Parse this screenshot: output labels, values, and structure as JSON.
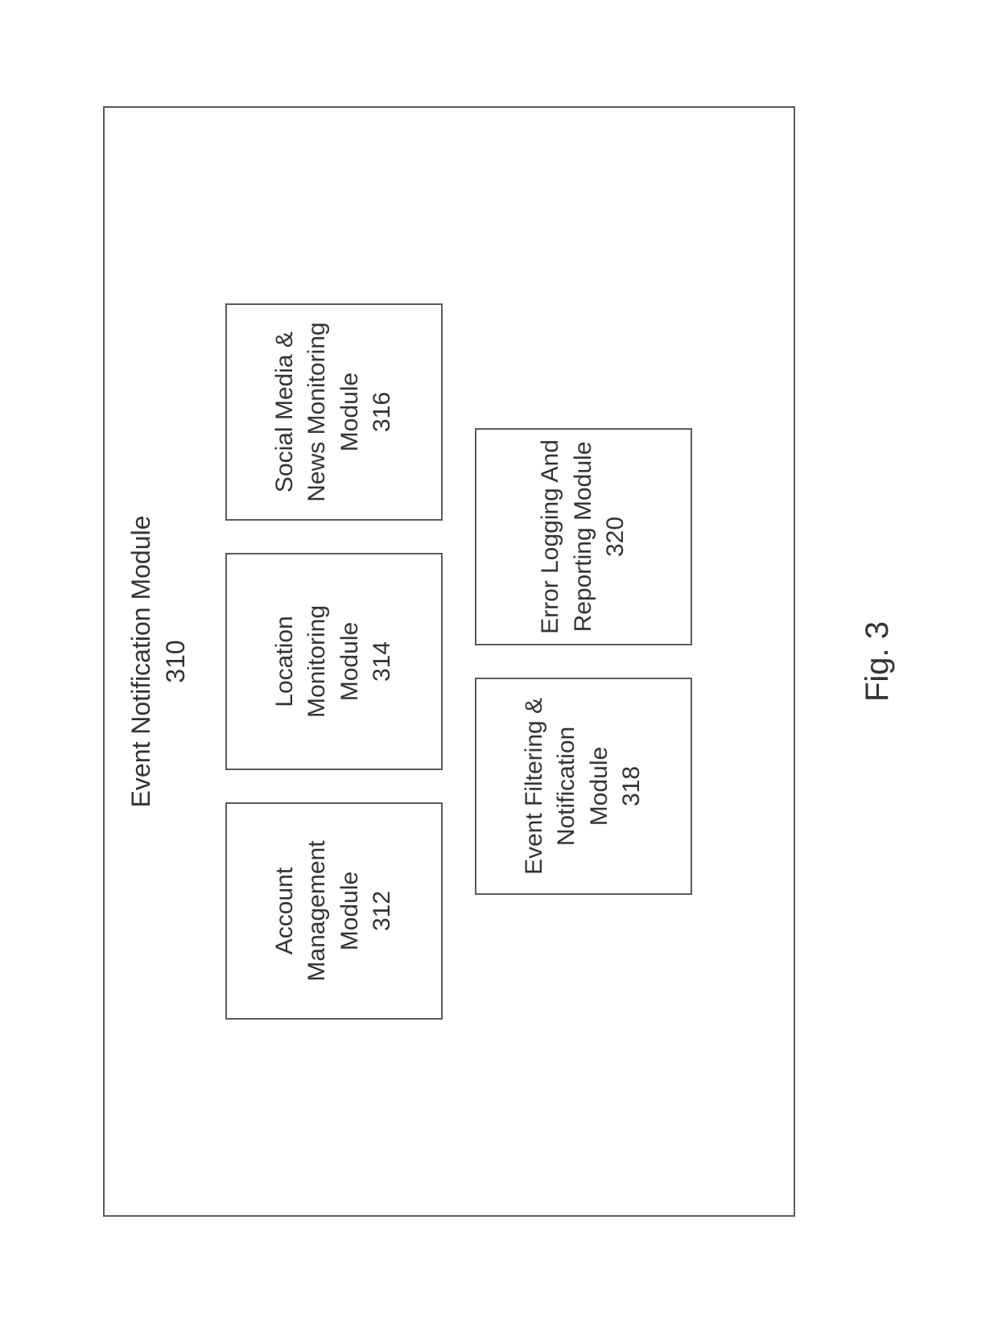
{
  "outer": {
    "title_l1": "Event Notification Module",
    "title_l2": "310"
  },
  "row1": {
    "m1_l1": "Account",
    "m1_l2": "Management",
    "m1_l3": "Module",
    "m1_l4": "312",
    "m2_l1": "Location",
    "m2_l2": "Monitoring Module",
    "m2_l3": "314",
    "m3_l1": "Social Media &",
    "m3_l2": "News Monitoring",
    "m3_l3": "Module",
    "m3_l4": "316"
  },
  "row2": {
    "m1_l1": "Event Filtering &",
    "m1_l2": "Notification",
    "m1_l3": "Module",
    "m1_l4": "318",
    "m2_l1": "Error Logging And",
    "m2_l2": "Reporting Module",
    "m2_l3": "320"
  },
  "figure_label": "Fig. 3"
}
